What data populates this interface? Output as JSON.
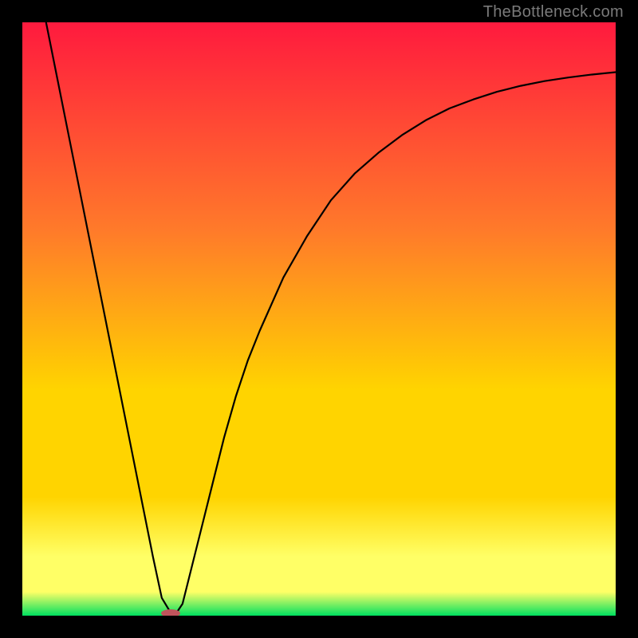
{
  "watermark": "TheBottleneck.com",
  "chart_data": {
    "type": "line",
    "title": "",
    "xlabel": "",
    "ylabel": "",
    "xlim": [
      0,
      100
    ],
    "ylim": [
      0,
      100
    ],
    "gradient_colors": {
      "top": "#ff1a3e",
      "mid_upper": "#ff7a2a",
      "mid": "#ffd400",
      "lower_band": "#ffff66",
      "bottom": "#00e060"
    },
    "series": [
      {
        "name": "bottleneck-curve",
        "x": [
          4,
          6,
          8,
          10,
          12,
          14,
          16,
          18,
          20,
          22,
          23.5,
          25,
          26,
          27,
          28,
          30,
          32,
          34,
          36,
          38,
          40,
          44,
          48,
          52,
          56,
          60,
          64,
          68,
          72,
          76,
          80,
          84,
          88,
          92,
          96,
          100
        ],
        "y": [
          100,
          90,
          80,
          70,
          60,
          50,
          40,
          30,
          20,
          10,
          3,
          0.5,
          0.5,
          2,
          6,
          14,
          22,
          30,
          37,
          43,
          48,
          57,
          64,
          70,
          74.5,
          78,
          81,
          83.5,
          85.5,
          87,
          88.3,
          89.3,
          90.1,
          90.7,
          91.2,
          91.6
        ]
      }
    ],
    "marker": {
      "name": "optimal-marker",
      "x": 25,
      "y": 0,
      "color": "#c0545c",
      "rx": 12,
      "ry": 5
    }
  }
}
